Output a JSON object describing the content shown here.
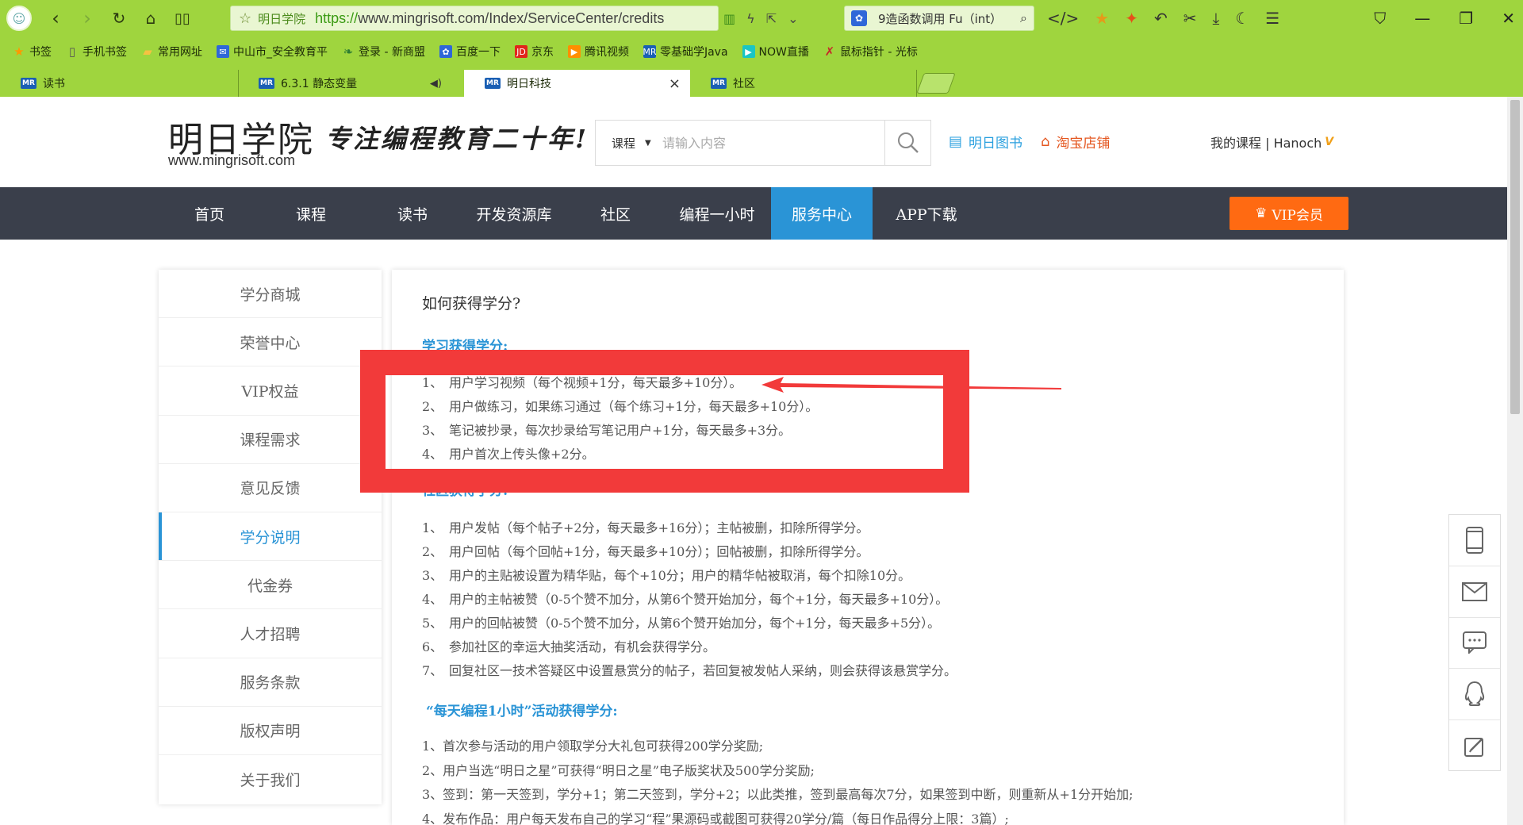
{
  "browser": {
    "address": {
      "site_label": "明日学院",
      "url_scheme": "https://",
      "url_rest": "www.mingrisoft.com/Index/ServiceCenter/credits"
    },
    "search_engine_text": "9造函数调用 Fu（int）",
    "bookmarks": [
      {
        "label": "书签",
        "icon": "star-icon",
        "color": "#ff9800"
      },
      {
        "label": "手机书签",
        "icon": "phone-icon",
        "color": "#555555"
      },
      {
        "label": "常用网址",
        "icon": "folder-icon",
        "color": "#f5c242"
      },
      {
        "label": "中山市_安全教育平",
        "icon": "mail-icon",
        "color": "#2f67d8"
      },
      {
        "label": "登录 - 新商盟",
        "icon": "leaf-icon",
        "color": "#2e7d32"
      },
      {
        "label": "百度一下",
        "icon": "paw-icon",
        "color": "#2f67d8"
      },
      {
        "label": "京东",
        "icon": "jd-icon",
        "color": "#e1251b"
      },
      {
        "label": "腾讯视频",
        "icon": "play-icon",
        "color": "#ff8f00"
      },
      {
        "label": "零基础学Java",
        "icon": "mr-icon",
        "color": "#1a5fb4"
      },
      {
        "label": "NOW直播",
        "icon": "now-icon",
        "color": "#19c5c5"
      },
      {
        "label": "鼠标指针 - 光标",
        "icon": "cursor-icon",
        "color": "#c62828"
      }
    ],
    "tabs": [
      {
        "label": "读书",
        "active": false
      },
      {
        "label": "6.3.1 静态变量",
        "active": false
      },
      {
        "label": "明日科技",
        "active": true
      },
      {
        "label": "社区",
        "active": false
      }
    ]
  },
  "header": {
    "logo_main": "明日学院",
    "logo_url": "www.mingrisoft.com",
    "slogan": "专注编程教育二十年!",
    "search_category": "课程",
    "search_placeholder": "请输入内容",
    "link_book": "明日图书",
    "link_taobao": "淘宝店铺",
    "user_text": "我的课程 | Hanoch",
    "user_badge": "V",
    "accent_blue": "#2a94d6",
    "accent_orange": "#ff6a12"
  },
  "nav": {
    "items": [
      "首页",
      "课程",
      "读书",
      "开发资源库",
      "社区",
      "编程一小时",
      "服务中心",
      "APP下载"
    ],
    "active_index": 6,
    "vip_label": "VIP会员"
  },
  "sidebar": {
    "items": [
      "学分商城",
      "荣誉中心",
      "VIP权益",
      "课程需求",
      "意见反馈",
      "学分说明",
      "代金券",
      "人才招聘",
      "服务条款",
      "版权声明",
      "关于我们"
    ],
    "active_index": 5
  },
  "content": {
    "title": "如何获得学分?",
    "section1": {
      "title": "学习获得学分:",
      "rules": [
        {
          "num": "1、",
          "text": "用户学习视频（每个视频+1分，每天最多+10分）。"
        },
        {
          "num": "2、",
          "text": "用户做练习，如果练习通过（每个练习+1分，每天最多+10分）。"
        },
        {
          "num": "3、",
          "text": "笔记被抄录，每次抄录给写笔记用户+1分，每天最多+3分。"
        },
        {
          "num": "4、",
          "text": "用户首次上传头像+2分。"
        }
      ]
    },
    "section2": {
      "title": "社区获得学分:",
      "rules": [
        {
          "num": "1、",
          "text": "用户发帖（每个帖子+2分，每天最多+16分）；主帖被删，扣除所得学分。"
        },
        {
          "num": "2、",
          "text": "用户回帖（每个回帖+1分，每天最多+10分）；回帖被删，扣除所得学分。"
        },
        {
          "num": "3、",
          "text": "用户的主贴被设置为精华贴，每个+10分；用户的精华帖被取消，每个扣除10分。"
        },
        {
          "num": "4、",
          "text": "用户的主帖被赞（0-5个赞不加分，从第6个赞开始加分，每个+1分，每天最多+10分）。"
        },
        {
          "num": "5、",
          "text": "用户的回帖被赞（0-5个赞不加分，从第6个赞开始加分，每个+1分，每天最多+5分）。"
        },
        {
          "num": "6、",
          "text": "参加社区的幸运大抽奖活动，有机会获得学分。"
        },
        {
          "num": "7、",
          "text": "回复社区一技术答疑区中设置悬赏分的帖子，若回复被发帖人采纳，则会获得该悬赏学分。"
        }
      ]
    },
    "section3": {
      "title": "“每天编程1小时”活动获得学分:",
      "rules": [
        "1、首次参与活动的用户领取学分大礼包可获得200学分奖励;",
        "2、用户当选“明日之星”可获得“明日之星”电子版奖状及500学分奖励;",
        "3、签到：第一天签到，学分+1；第二天签到，学分+2；以此类推，签到最高每次7分，如果签到中断，则重新从+1分开始加;",
        "4、发布作品：用户每天发布自己的学习“程”果源码或截图可获得20学分/篇（每日作品得分上限：3篇）;"
      ]
    }
  },
  "annotation_color": "#f23a3a",
  "float_tools": [
    "phone-icon",
    "mail-icon",
    "chat-icon",
    "qq-icon",
    "edit-icon"
  ]
}
